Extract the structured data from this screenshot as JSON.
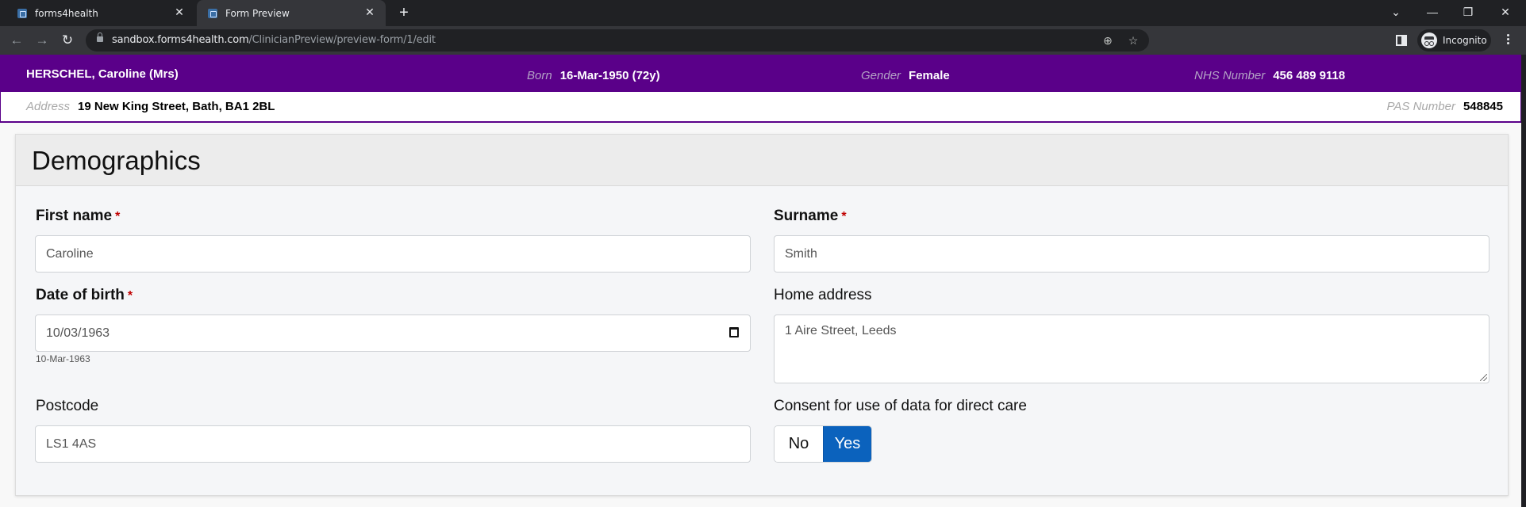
{
  "browser": {
    "tabs": [
      {
        "title": "forms4health",
        "active": false
      },
      {
        "title": "Form Preview",
        "active": true
      }
    ],
    "url_host": "sandbox.forms4health.com",
    "url_path": "/ClinicianPreview/preview-form/1/edit",
    "profile_label": "Incognito"
  },
  "patient_banner": {
    "name": "HERSCHEL, Caroline (Mrs)",
    "born_label": "Born",
    "born_value": "16-Mar-1950 (72y)",
    "gender_label": "Gender",
    "gender_value": "Female",
    "nhs_label": "NHS Number",
    "nhs_value": "456 489 9118",
    "address_label": "Address",
    "address_value": "19 New King Street, Bath, BA1 2BL",
    "pas_label": "PAS Number",
    "pas_value": "548845",
    "color": "#5a0089"
  },
  "form": {
    "title": "Demographics",
    "required_marker": "*",
    "fields": {
      "first_name": {
        "label": "First name",
        "value": "Caroline",
        "required": true
      },
      "surname": {
        "label": "Surname",
        "value": "Smith",
        "required": true
      },
      "dob": {
        "label": "Date of birth",
        "value": "10/03/1963",
        "help": "10-Mar-1963",
        "required": true
      },
      "home_address": {
        "label": "Home address",
        "value": "1 Aire Street, Leeds",
        "required": false
      },
      "postcode": {
        "label": "Postcode",
        "value": "LS1 4AS",
        "required": false
      },
      "consent": {
        "label": "Consent for use of data for direct care",
        "options": [
          "No",
          "Yes"
        ],
        "selected": "Yes",
        "accent": "#0b62bd"
      }
    }
  }
}
